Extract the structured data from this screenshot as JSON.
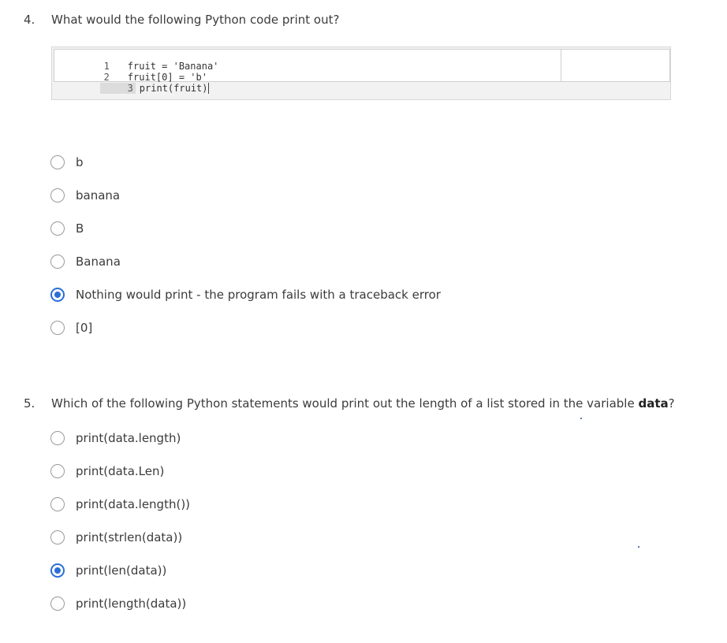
{
  "question4": {
    "number": "4.",
    "text": "What would the following Python code print out?",
    "code": {
      "lines": [
        {
          "num": "1",
          "text": "fruit = 'Banana'"
        },
        {
          "num": "2",
          "text": "fruit[0] = 'b'"
        },
        {
          "num": "3",
          "text": "print(fruit)"
        }
      ],
      "output": ""
    },
    "options": [
      {
        "label": "b",
        "selected": false
      },
      {
        "label": "banana",
        "selected": false
      },
      {
        "label": "B",
        "selected": false
      },
      {
        "label": "Banana",
        "selected": false
      },
      {
        "label": "Nothing would print - the program fails with a traceback error",
        "selected": true
      },
      {
        "label": "[0]",
        "selected": false
      }
    ]
  },
  "question5": {
    "number": "5.",
    "text_before": "Which of the following Python statements would print out the length of a list stored in the variable ",
    "text_bold": "data",
    "text_after": "?",
    "options": [
      {
        "label": "print(data.length)",
        "selected": false
      },
      {
        "label": "print(data.Len)",
        "selected": false
      },
      {
        "label": "print(data.length())",
        "selected": false
      },
      {
        "label": "print(strlen(data))",
        "selected": false
      },
      {
        "label": "print(len(data))",
        "selected": true
      },
      {
        "label": "print(length(data))",
        "selected": false
      }
    ]
  },
  "colors": {
    "accent": "#2a6fd6",
    "text": "#3b3b3b",
    "radio_border": "#9a9a9a"
  }
}
